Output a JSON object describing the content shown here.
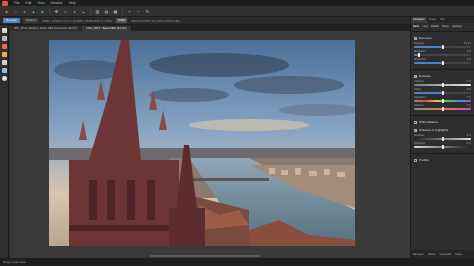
{
  "menubar": {
    "items": [
      "File",
      "Edit",
      "View",
      "Window",
      "Help"
    ]
  },
  "contextbar": {
    "develop_label": "Develop",
    "cancel_label": "Cancel",
    "info_text": "5000 × 3700px (17.3 / 18.5MP), 8MB RAM (1),JPEG",
    "tag_label": "RAW",
    "meta_text": "NIKON D7500 18-140mm f/3.5-5.6G"
  },
  "doctabs": [
    "IMG_8743_Basilica_Rhein.NEF [Unsaved] (28.9%)",
    "DSC_0872 - Basel.NEF (33.1%)"
  ],
  "right_panel": {
    "tabs": [
      "Histogram",
      "Scope",
      "Info"
    ],
    "sub_tabs": [
      "Basic",
      "Lens",
      "Details",
      "Tones",
      "Overlays"
    ],
    "sections": [
      {
        "title": "Exposure",
        "enabled": true,
        "sliders": [
          {
            "label": "Exposure",
            "value": "0.0 eV",
            "pct": 0.5
          },
          {
            "label": "Blackpoint",
            "value": "0 %",
            "pct": 0.08
          },
          {
            "label": "Brightness",
            "value": "0 %",
            "pct": 0.5
          }
        ]
      },
      {
        "title": "Enhance",
        "enabled": true,
        "sliders": [
          {
            "label": "Contrast",
            "value": "0 %",
            "pct": 0.5
          },
          {
            "label": "Clarity",
            "value": "0 %",
            "pct": 0.5
          },
          {
            "label": "Saturation",
            "value": "0 %",
            "pct": 0.5
          },
          {
            "label": "Vibrance",
            "value": "0 %",
            "pct": 0.5
          }
        ]
      },
      {
        "title": "White Balance",
        "enabled": false,
        "sliders": []
      },
      {
        "title": "Shadows & Highlights",
        "enabled": true,
        "sliders": [
          {
            "label": "Shadows",
            "value": "0 %",
            "pct": 0.5
          },
          {
            "label": "Highlights",
            "value": "0 %",
            "pct": 0.5
          }
        ]
      },
      {
        "title": "Profiles",
        "enabled": false,
        "sliders": []
      }
    ],
    "bottom_tabs": [
      "Navigator",
      "History",
      "Snapshots",
      "Focus"
    ]
  },
  "statusbar": {
    "text": "Drag to pan view."
  },
  "colors": {
    "accent": "#4a83c7",
    "app_bg": "#2b2b2b"
  }
}
